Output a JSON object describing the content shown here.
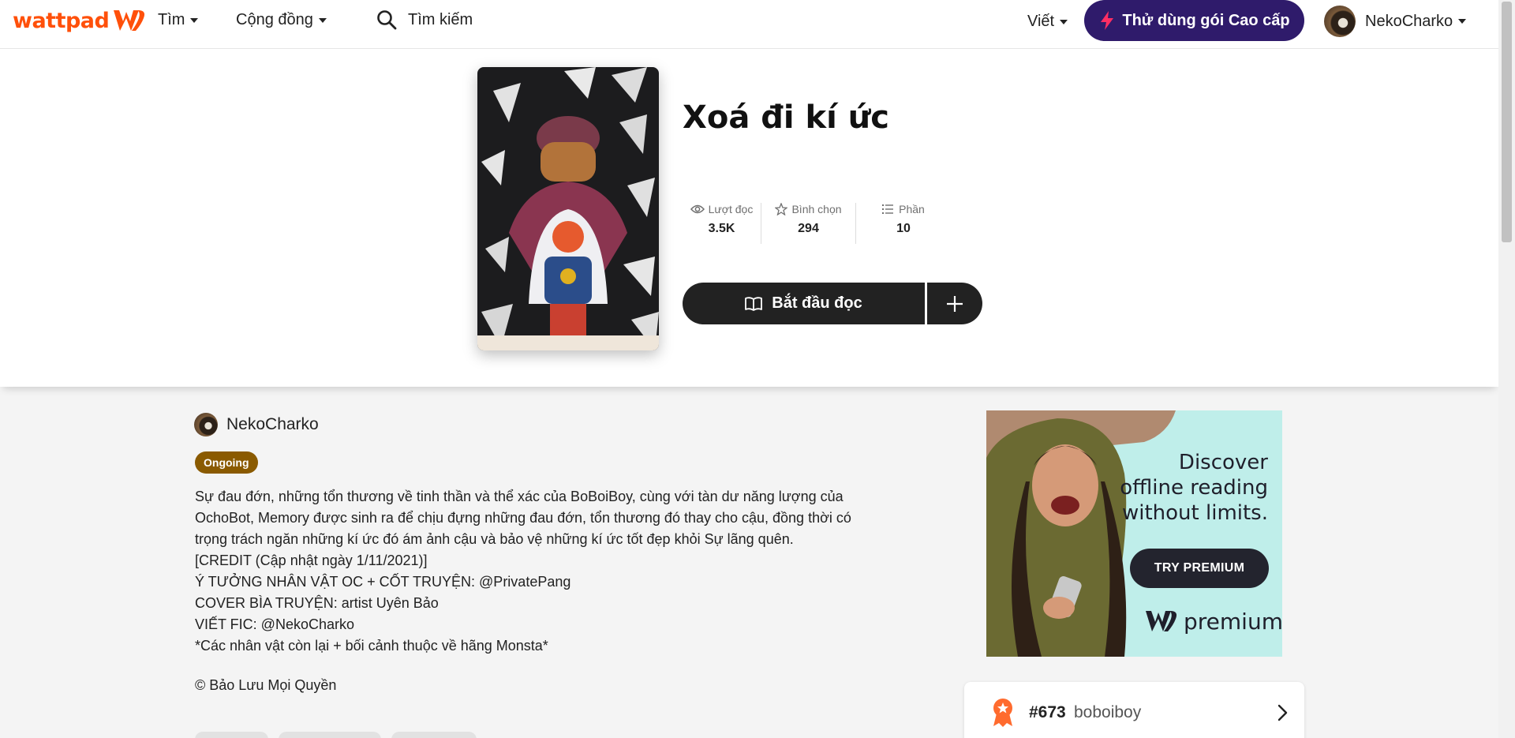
{
  "nav": {
    "logo_text": "wattpad",
    "browse_label": "Tìm",
    "community_label": "Cộng đồng",
    "search_placeholder": "Tìm kiếm",
    "write_label": "Viết",
    "premium_label": "Thử dùng gói Cao cấp",
    "username": "NekoCharko"
  },
  "story": {
    "title": "Xoá đi kí ức",
    "stats": [
      {
        "label": "Lượt đọc",
        "value": "3.5K",
        "icon": "eye-icon"
      },
      {
        "label": "Bình chọn",
        "value": "294",
        "icon": "star-icon"
      },
      {
        "label": "Phần",
        "value": "10",
        "icon": "list-icon"
      }
    ],
    "read_button": "Bắt đầu đọc",
    "author": "NekoCharko",
    "status": "Ongoing",
    "description": [
      "Sự đau đớn, những tổn thương về tinh thần và thể xác của BoBoiBoy, cùng với tàn dư năng lượng của",
      "OchoBot, Memory được sinh ra để chịu đựng những đau đớn, tổn thương đó thay cho cậu, đồng thời có",
      "trọng trách ngăn những kí ức đó ám ảnh cậu và bảo vệ những kí ức tốt đẹp khỏi Sự lãng quên.",
      "[CREDIT (Cập nhật ngày 1/11/2021)]",
      "Ý TƯỞNG NHÂN VẬT OC + CỐT TRUYỆN: @PrivatePang",
      "COVER BÌA TRUYỆN: artist Uyên Bảo",
      "VIẾT FIC: @NekoCharko",
      "*Các nhân vật còn lại + bối cảnh thuộc về hãng Monsta*"
    ],
    "copyright": "© Bảo Lưu Mọi Quyền"
  },
  "ad": {
    "lines": [
      "Discover",
      "offline reading",
      "without limits."
    ],
    "button": "TRY PREMIUM",
    "brand": "premium"
  },
  "ranking": {
    "rank": "#673",
    "tag": "boboiboy"
  },
  "colors": {
    "brand_orange": "#ff500a",
    "premium_purple": "#2f1b6b",
    "status_brown": "#8a5a00",
    "ad_bg": "#bfeeea"
  }
}
